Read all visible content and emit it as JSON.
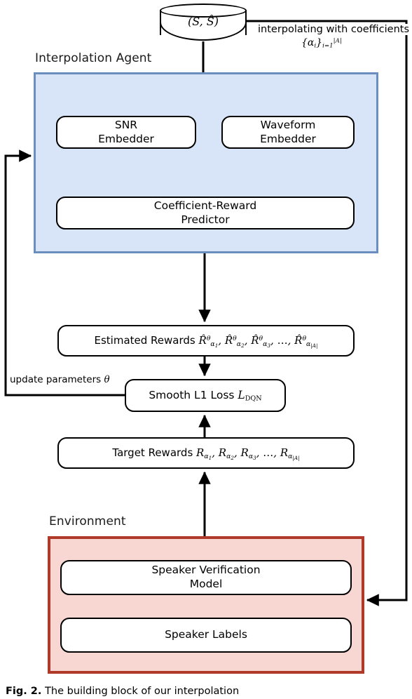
{
  "figure": {
    "groups": {
      "agent_label": "Interpolation Agent",
      "environment_label": "Environment"
    },
    "nodes": {
      "database": "(S, Ŝ)",
      "snr_embedder": "SNR\nEmbedder",
      "snr_embedder_line1": "SNR",
      "snr_embedder_line2": "Embedder",
      "waveform_embedder_line1": "Waveform",
      "waveform_embedder_line2": "Embedder",
      "predictor_line1": "Coefficient-Reward",
      "predictor_line2": "Predictor",
      "estimated_rewards_label": "Estimated Rewards",
      "estimated_rewards_math": "R̂θα1, R̂θα2, R̂θα3, …, R̂θα|A|",
      "loss_label": "Smooth L1 Loss",
      "loss_symbol": "LDQN",
      "target_rewards_label": "Target Rewards",
      "target_rewards_math": "Rα1, Rα2, Rα3, …, Rα|A|",
      "speaker_verification_line1": "Speaker Verification",
      "speaker_verification_line2": "Model",
      "speaker_labels": "Speaker Labels"
    },
    "annotations": {
      "interpolating": "interpolating with coefficients",
      "coefficients_math": "{αi}i=1|A|",
      "update_parameters": "update parameters θ"
    },
    "colors": {
      "agent_fill": "#d8e5f8",
      "agent_border": "#6c8ebf",
      "environment_fill": "#f8d7d3",
      "environment_border": "#b03a2a",
      "node_fill": "#ffffff",
      "node_border": "#000000",
      "wire": "#000000"
    },
    "caption": {
      "figure_number": "Fig. 2.",
      "text": "The building block of our interpolation"
    }
  }
}
